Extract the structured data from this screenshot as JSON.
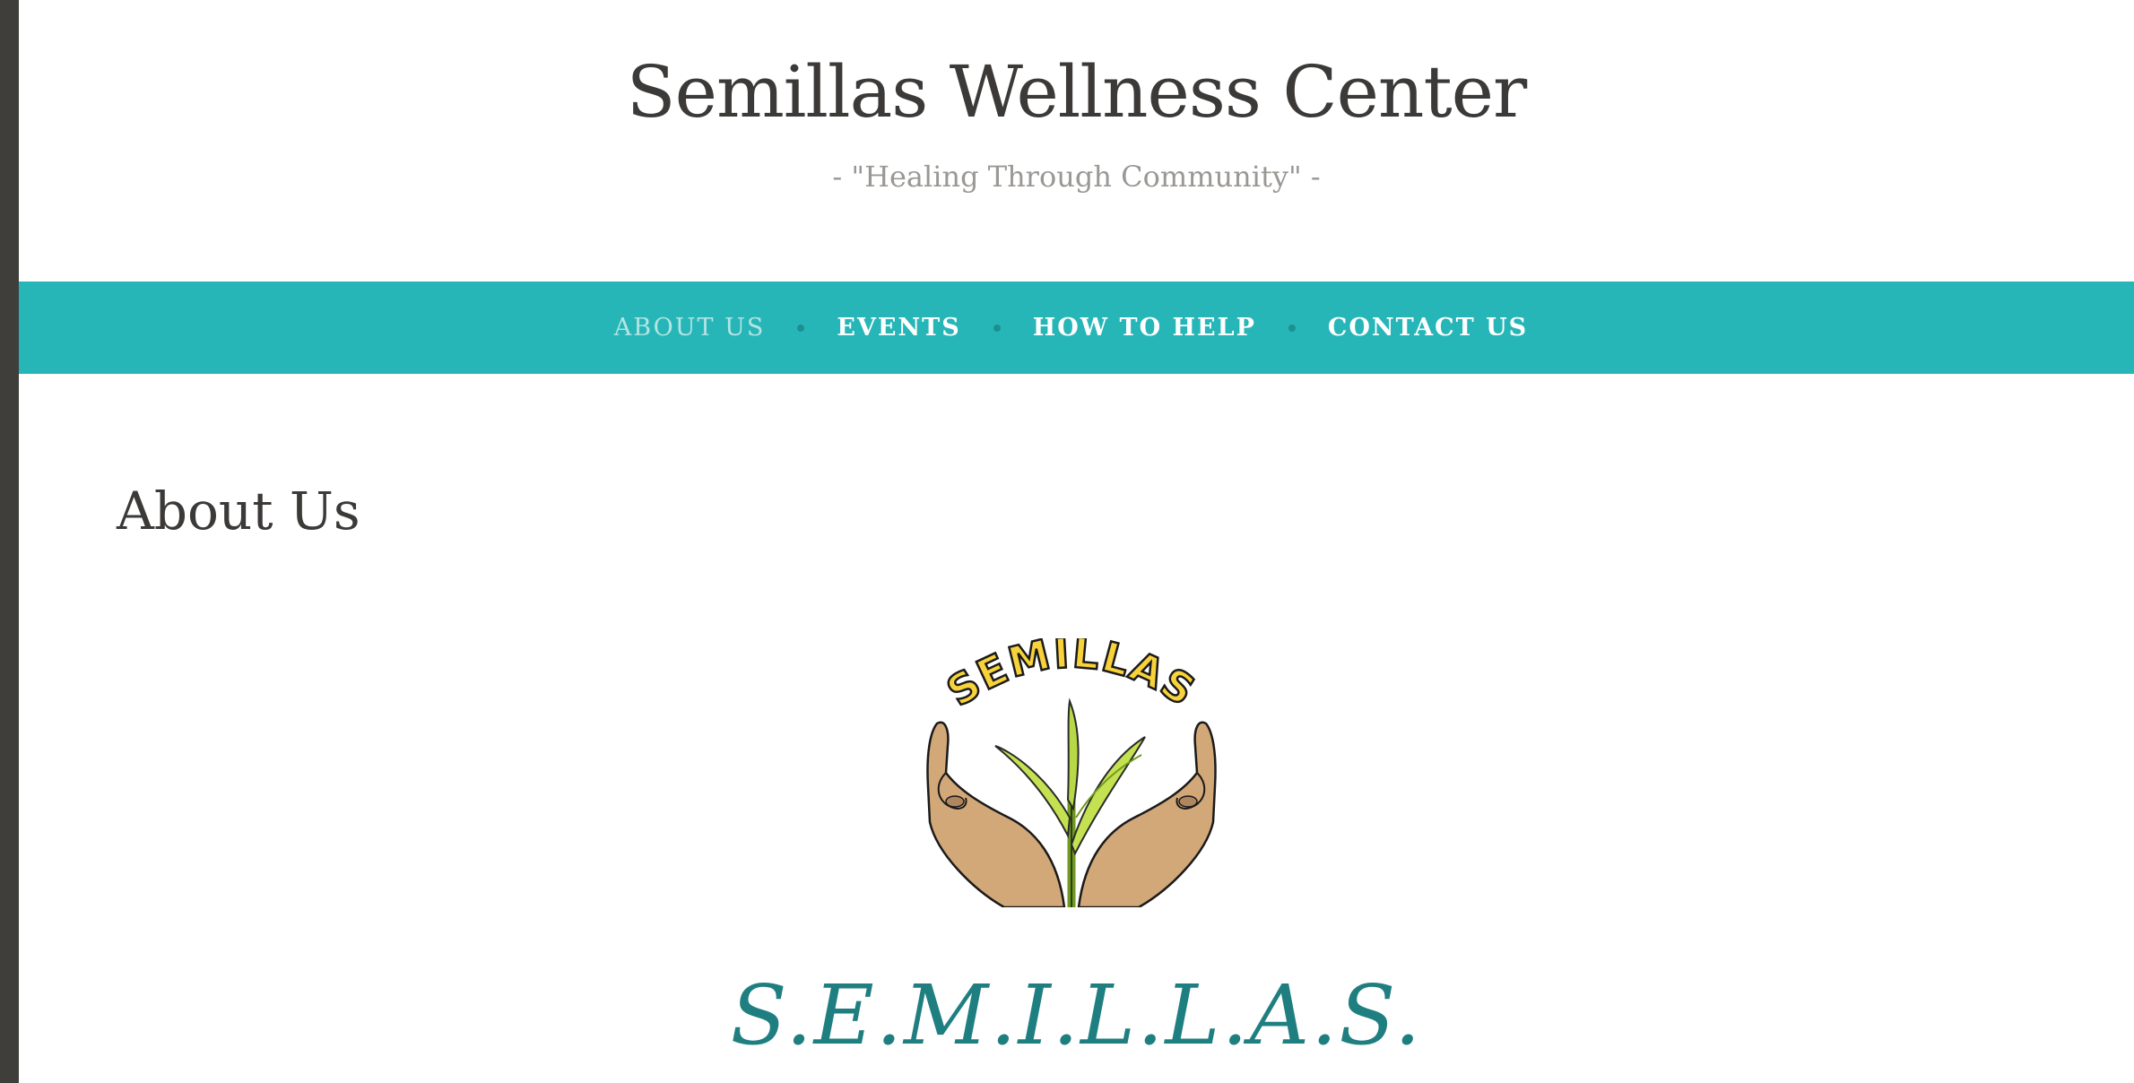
{
  "header": {
    "site_title": "Semillas Wellness Center",
    "tagline": "- \"Healing Through Community\" -"
  },
  "nav": {
    "items": [
      {
        "label": "ABOUT US",
        "active": true
      },
      {
        "label": "EVENTS",
        "active": false
      },
      {
        "label": "HOW TO HELP",
        "active": false
      },
      {
        "label": "CONTACT US",
        "active": false
      }
    ]
  },
  "main": {
    "page_title": "About Us",
    "logo_text": "SEMILLAS",
    "acronym": "S.E.M.I.L.L.A.S."
  },
  "colors": {
    "nav_background": "#27b6b7",
    "acronym": "#1f7f80",
    "left_bar": "#403e3b"
  }
}
